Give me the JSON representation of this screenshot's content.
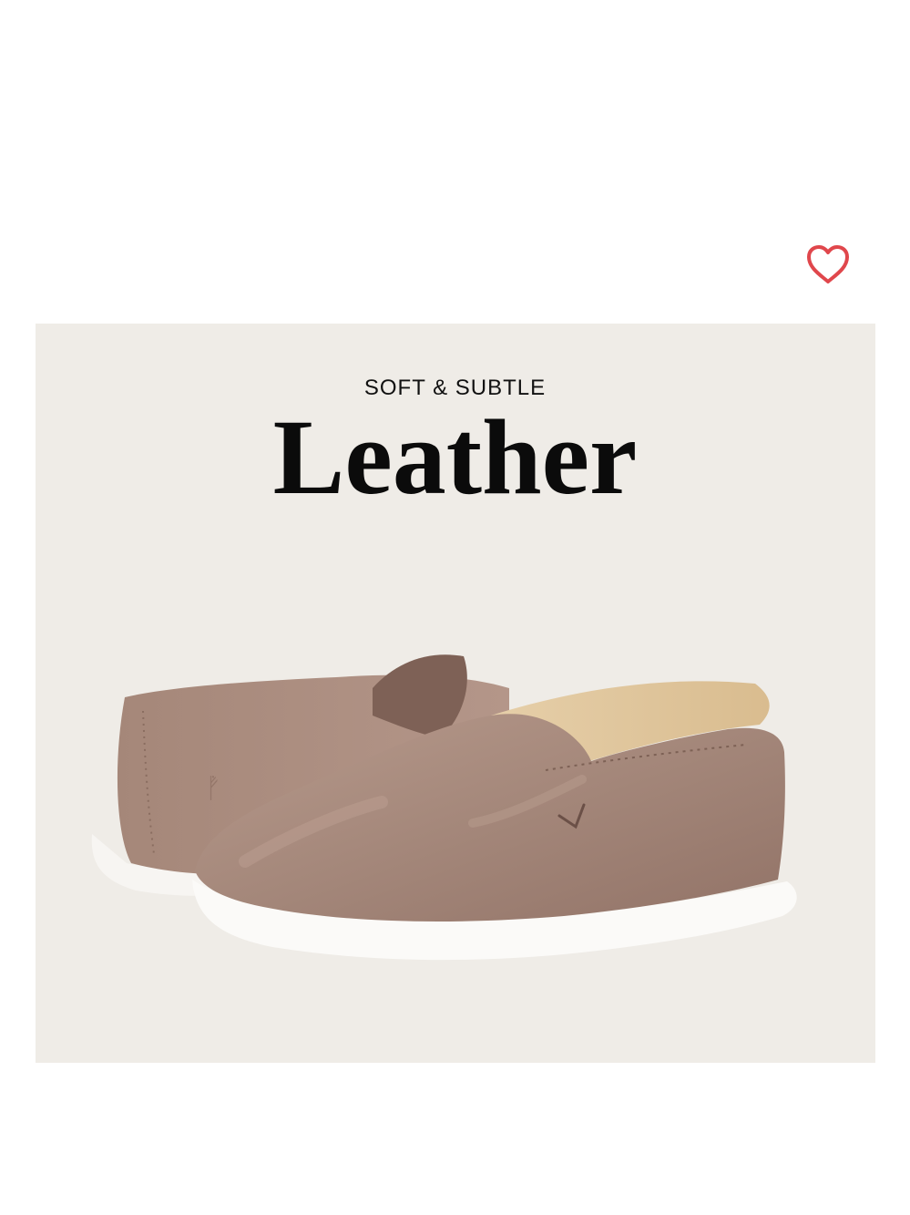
{
  "card": {
    "eyebrow": "SOFT & SUBTLE",
    "headline": "Leather"
  },
  "favorite": {
    "icon": "heart-outline-icon",
    "color": "#e0474c"
  },
  "colors": {
    "card_background": "#efece7",
    "leather": "#a9897b",
    "sole": "#ffffff",
    "heading_text": "#0b0b0b"
  }
}
